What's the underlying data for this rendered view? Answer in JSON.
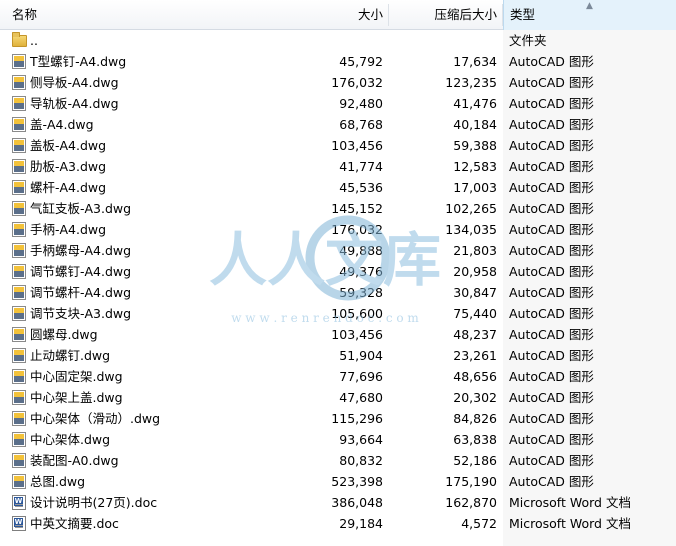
{
  "columns": {
    "name": "名称",
    "size": "大小",
    "compressed": "压缩后大小",
    "type": "类型"
  },
  "rows": [
    {
      "icon": "folder-icon",
      "name": "..",
      "size": "",
      "compressed": "",
      "type": "文件夹"
    },
    {
      "icon": "autocad-file-icon",
      "name": "T型螺钉-A4.dwg",
      "size": "45,792",
      "compressed": "17,634",
      "type": "AutoCAD 图形"
    },
    {
      "icon": "autocad-file-icon",
      "name": "侧导板-A4.dwg",
      "size": "176,032",
      "compressed": "123,235",
      "type": "AutoCAD 图形"
    },
    {
      "icon": "autocad-file-icon",
      "name": "导轨板-A4.dwg",
      "size": "92,480",
      "compressed": "41,476",
      "type": "AutoCAD 图形"
    },
    {
      "icon": "autocad-file-icon",
      "name": "盖-A4.dwg",
      "size": "68,768",
      "compressed": "40,184",
      "type": "AutoCAD 图形"
    },
    {
      "icon": "autocad-file-icon",
      "name": "盖板-A4.dwg",
      "size": "103,456",
      "compressed": "59,388",
      "type": "AutoCAD 图形"
    },
    {
      "icon": "autocad-file-icon",
      "name": "肋板-A3.dwg",
      "size": "41,774",
      "compressed": "12,583",
      "type": "AutoCAD 图形"
    },
    {
      "icon": "autocad-file-icon",
      "name": "螺杆-A4.dwg",
      "size": "45,536",
      "compressed": "17,003",
      "type": "AutoCAD 图形"
    },
    {
      "icon": "autocad-file-icon",
      "name": "气缸支板-A3.dwg",
      "size": "145,152",
      "compressed": "102,265",
      "type": "AutoCAD 图形"
    },
    {
      "icon": "autocad-file-icon",
      "name": "手柄-A4.dwg",
      "size": "176,032",
      "compressed": "134,035",
      "type": "AutoCAD 图形"
    },
    {
      "icon": "autocad-file-icon",
      "name": "手柄螺母-A4.dwg",
      "size": "49,888",
      "compressed": "21,803",
      "type": "AutoCAD 图形"
    },
    {
      "icon": "autocad-file-icon",
      "name": "调节螺钉-A4.dwg",
      "size": "49,376",
      "compressed": "20,958",
      "type": "AutoCAD 图形"
    },
    {
      "icon": "autocad-file-icon",
      "name": "调节螺杆-A4.dwg",
      "size": "59,328",
      "compressed": "30,847",
      "type": "AutoCAD 图形"
    },
    {
      "icon": "autocad-file-icon",
      "name": "调节支块-A3.dwg",
      "size": "105,600",
      "compressed": "75,440",
      "type": "AutoCAD 图形"
    },
    {
      "icon": "autocad-file-icon",
      "name": "圆螺母.dwg",
      "size": "103,456",
      "compressed": "48,237",
      "type": "AutoCAD 图形"
    },
    {
      "icon": "autocad-file-icon",
      "name": "止动螺钉.dwg",
      "size": "51,904",
      "compressed": "23,261",
      "type": "AutoCAD 图形"
    },
    {
      "icon": "autocad-file-icon",
      "name": "中心固定架.dwg",
      "size": "77,696",
      "compressed": "48,656",
      "type": "AutoCAD 图形"
    },
    {
      "icon": "autocad-file-icon",
      "name": "中心架上盖.dwg",
      "size": "47,680",
      "compressed": "20,302",
      "type": "AutoCAD 图形"
    },
    {
      "icon": "autocad-file-icon",
      "name": "中心架体（滑动）.dwg",
      "size": "115,296",
      "compressed": "84,826",
      "type": "AutoCAD 图形"
    },
    {
      "icon": "autocad-file-icon",
      "name": "中心架体.dwg",
      "size": "93,664",
      "compressed": "63,838",
      "type": "AutoCAD 图形"
    },
    {
      "icon": "autocad-file-icon",
      "name": "装配图-A0.dwg",
      "size": "80,832",
      "compressed": "52,186",
      "type": "AutoCAD 图形"
    },
    {
      "icon": "autocad-file-icon",
      "name": "总图.dwg",
      "size": "523,398",
      "compressed": "175,190",
      "type": "AutoCAD 图形"
    },
    {
      "icon": "word-doc-icon",
      "name": "设计说明书(27页).doc",
      "size": "386,048",
      "compressed": "162,870",
      "type": "Microsoft Word 文档"
    },
    {
      "icon": "word-doc-icon",
      "name": "中英文摘要.doc",
      "size": "29,184",
      "compressed": "4,572",
      "type": "Microsoft Word 文档"
    }
  ],
  "watermark": {
    "text": "人人文库",
    "url": "w w w . r e n r e n d o c . c o m"
  }
}
